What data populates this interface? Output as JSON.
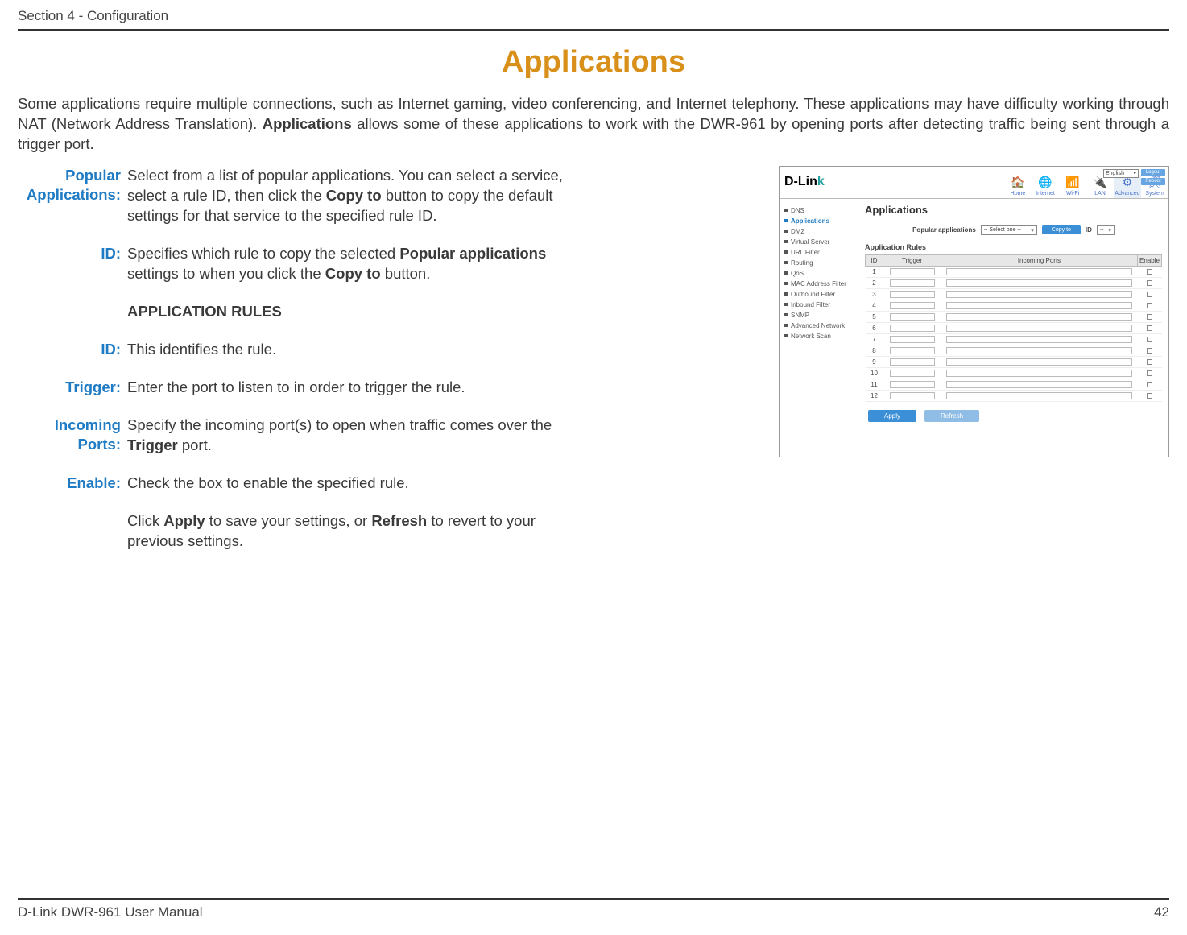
{
  "header_section": "Section 4 - Configuration",
  "page_title": "Applications",
  "intro": {
    "part1": "Some applications require multiple connections, such as Internet gaming, video conferencing, and Internet telephony. These applications may have difficulty working through NAT (Network Address Translation). ",
    "bold1": "Applications",
    "part2": " allows some of these applications to work with the DWR-961 by opening ports after detecting traffic being sent through a trigger port."
  },
  "defs": {
    "popular_label": "Popular Applications:",
    "popular_text_a": "Select from a list of popular applications. You can select a service, select a rule ID, then click the ",
    "popular_bold": "Copy to",
    "popular_text_b": " button to copy the default settings for that service to the specified rule ID.",
    "id1_label": "ID:",
    "id1_text_a": "Specifies which rule to copy the selected ",
    "id1_bold1": "Popular applications",
    "id1_text_b": " settings to when you click the ",
    "id1_bold2": "Copy to",
    "id1_text_c": " button.",
    "section_heading": "APPLICATION RULES",
    "id2_label": "ID:",
    "id2_text": "This identifies the rule.",
    "trigger_label": "Trigger:",
    "trigger_text": "Enter the port to listen to in order to trigger the rule.",
    "incoming_label": "Incoming Ports:",
    "incoming_text_a": "Specify the incoming port(s) to open when traffic comes over the ",
    "incoming_bold": "Trigger",
    "incoming_text_b": " port.",
    "enable_label": "Enable:",
    "enable_text": "Check the box to enable the specified rule.",
    "final_a": "Click ",
    "final_b1": "Apply",
    "final_b": " to save your settings, or ",
    "final_b2": "Refresh",
    "final_c": " to revert to your previous settings."
  },
  "screenshot": {
    "logo_main": "D-Lin",
    "logo_suffix": "k",
    "lang": "English",
    "btn_logout": "Logout",
    "btn_reboot": "Reboot",
    "tabs": [
      {
        "label": "Home",
        "icon": "🏠"
      },
      {
        "label": "Internet",
        "icon": "🌐"
      },
      {
        "label": "Wi-Fi",
        "icon": "📶"
      },
      {
        "label": "LAN",
        "icon": "🔌"
      },
      {
        "label": "Advanced",
        "icon": "⚙"
      },
      {
        "label": "System",
        "icon": "🛠"
      }
    ],
    "side": [
      "DNS",
      "Applications",
      "DMZ",
      "Virtual Server",
      "URL Filter",
      "Routing",
      "QoS",
      "MAC Address Filter",
      "Outbound Filter",
      "Inbound Filter",
      "SNMP",
      "Advanced Network",
      "Network Scan"
    ],
    "panel_title": "Applications",
    "popular_label": "Popular applications",
    "popular_sel": "-- Select one --",
    "copy_btn": "Copy to",
    "id_label": "ID",
    "id_sel": "--",
    "rules_heading": "Application Rules",
    "th_id": "ID",
    "th_trigger": "Trigger",
    "th_incoming": "Incoming Ports",
    "th_enable": "Enable",
    "row_ids": [
      "1",
      "2",
      "3",
      "4",
      "5",
      "6",
      "7",
      "8",
      "9",
      "10",
      "11",
      "12"
    ],
    "apply": "Apply",
    "refresh": "Refresh"
  },
  "footer": {
    "left": "D-Link DWR-961 User Manual",
    "right": "42"
  }
}
